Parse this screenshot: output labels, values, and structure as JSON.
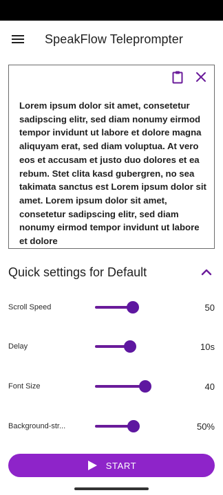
{
  "app_bar": {
    "title": "SpeakFlow Teleprompter",
    "menu_icon": "hamburger-menu-icon"
  },
  "script_box": {
    "paste_icon": "clipboard-icon",
    "clear_icon": "close-icon",
    "text": "Lorem ipsum dolor sit amet, consetetur sadipscing elitr, sed diam nonumy eirmod tempor invidunt ut labore et dolore magna aliquyam erat, sed diam voluptua. At vero eos et accusam et justo duo dolores et ea rebum. Stet clita kasd gubergren, no sea takimata sanctus est Lorem ipsum dolor sit amet. Lorem ipsum dolor sit amet, consetetur sadipscing elitr, sed diam nonumy eirmod tempor invidunt ut labore et dolore"
  },
  "quick_settings": {
    "title": "Quick settings for Default",
    "collapse_icon": "chevron-up-icon",
    "items": [
      {
        "label": "Scroll Speed",
        "value": "50",
        "level": 0.55
      },
      {
        "label": "Delay",
        "value": "10s",
        "level": 0.51
      },
      {
        "label": "Font Size",
        "value": "40",
        "level": 0.73
      },
      {
        "label": "Background-str...",
        "value": "50%",
        "level": 0.56
      }
    ]
  },
  "start_button": {
    "label": "START",
    "icon": "play-icon"
  },
  "colors": {
    "accent": "#6a1b9a",
    "button": "#8e24c9",
    "status_bar": "#000000"
  }
}
